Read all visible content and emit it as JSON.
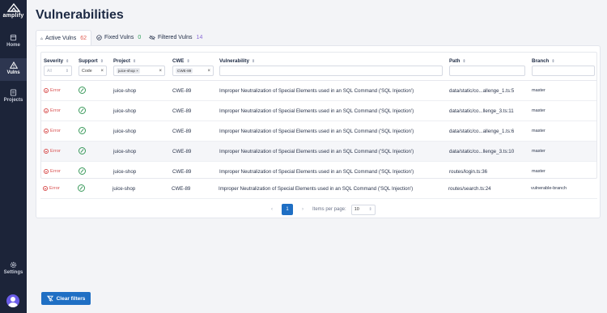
{
  "app": {
    "logo_text": "amplify"
  },
  "sidebar": {
    "items": [
      {
        "label": "Home",
        "icon": "home-icon"
      },
      {
        "label": "Vulns",
        "icon": "warning-icon",
        "active": true
      },
      {
        "label": "Projects",
        "icon": "projects-icon"
      },
      {
        "label": "Settings",
        "icon": "gear-icon"
      }
    ]
  },
  "page": {
    "title": "Vulnerabilities"
  },
  "tabs": [
    {
      "label": "Active Vulns",
      "count": "62",
      "count_color": "#e05a4f",
      "icon": "warning-icon"
    },
    {
      "label": "Fixed Vulns",
      "count": "0",
      "count_color": "#2e9e59",
      "icon": "check-circle-icon"
    },
    {
      "label": "Filtered Vulns",
      "count": "14",
      "count_color": "#8a6bd6",
      "icon": "eye-off-icon"
    }
  ],
  "table": {
    "headers": {
      "severity": "Severity",
      "support": "Support",
      "project": "Project",
      "cwe": "CWE",
      "vulnerability": "Vulnerability",
      "path": "Path",
      "branch": "Branch"
    },
    "filters": {
      "severity_placeholder": "All",
      "support_value": "Code",
      "project_chip": "juice-shop",
      "cwe_chip": "CWE-89"
    },
    "rows": [
      {
        "severity": "Error",
        "project": "juice-shop",
        "cwe": "CWE-89",
        "vulnerability": "Improper Neutralization of Special Elements used in an SQL Command ('SQL Injection')",
        "path": "data/static/co...allenge_1.ts:5",
        "branch": "master"
      },
      {
        "severity": "Error",
        "project": "juice-shop",
        "cwe": "CWE-89",
        "vulnerability": "Improper Neutralization of Special Elements used in an SQL Command ('SQL Injection')",
        "path": "data/static/co...llenge_3.ts:11",
        "branch": "master"
      },
      {
        "severity": "Error",
        "project": "juice-shop",
        "cwe": "CWE-89",
        "vulnerability": "Improper Neutralization of Special Elements used in an SQL Command ('SQL Injection')",
        "path": "data/static/co...allenge_1.ts:6",
        "branch": "master"
      },
      {
        "severity": "Error",
        "project": "juice-shop",
        "cwe": "CWE-89",
        "vulnerability": "Improper Neutralization of Special Elements used in an SQL Command ('SQL Injection')",
        "path": "data/static/co...llenge_3.ts:10",
        "branch": "master"
      },
      {
        "severity": "Error",
        "project": "juice-shop",
        "cwe": "CWE-89",
        "vulnerability": "Improper Neutralization of Special Elements used in an SQL Command ('SQL Injection')",
        "path": "routes/login.ts:36",
        "branch": "master"
      },
      {
        "severity": "Error",
        "project": "juice-shop",
        "cwe": "CWE-89",
        "vulnerability": "Improper Neutralization of Special Elements used in an SQL Command ('SQL Injection')",
        "path": "routes/search.ts:24",
        "branch": "vulnerable-branch"
      }
    ]
  },
  "pagination": {
    "current_page": "1",
    "items_per_page_label": "Items per page:",
    "items_per_page": "10"
  },
  "actions": {
    "clear_filters": "Clear filters"
  },
  "colors": {
    "accent": "#1f6fc4",
    "sidebar": "#1c2439",
    "error": "#d95050"
  }
}
